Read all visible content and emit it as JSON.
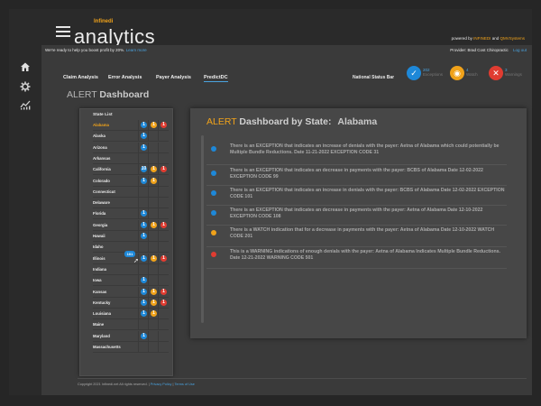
{
  "brand": {
    "small": "Infinedi",
    "big": "analytics"
  },
  "powered_by": {
    "prefix": "powered by",
    "infinedi": "INFINEDI",
    "and": "and",
    "qmv": "QMVSystems"
  },
  "promo": {
    "text": "We're ready to help you boost profit by 20%.",
    "link": "Learn more"
  },
  "provider": {
    "label": "Provider: Brad Cost Chiropractic",
    "logout": "Log out"
  },
  "tabs": [
    {
      "label": "Claim Analysis"
    },
    {
      "label": "Error Analysis"
    },
    {
      "label": "Payer Analysis"
    },
    {
      "label": "PredictDC"
    }
  ],
  "national_status": {
    "label": "National Status Bar",
    "items": [
      {
        "count": "202",
        "label": "Exceptions",
        "color": "#1e88d8",
        "icon": "check-icon"
      },
      {
        "count": "4",
        "label": "Watch",
        "color": "#f0a21a",
        "icon": "eye-icon"
      },
      {
        "count": "3",
        "label": "Warnings",
        "color": "#e03c31",
        "icon": "x-icon"
      }
    ]
  },
  "page": {
    "title_prefix": "ALERT",
    "title_bold": "Dashboard"
  },
  "state_list": {
    "heading": "State List",
    "selected": "Alabama",
    "badge": "101",
    "rows": [
      {
        "name": "Alabama",
        "b": "1",
        "o": "1",
        "r": "1"
      },
      {
        "name": "Alaska",
        "b": "1",
        "o": "",
        "r": ""
      },
      {
        "name": "Arizona",
        "b": "1",
        "o": "",
        "r": ""
      },
      {
        "name": "Arkansas",
        "b": "",
        "o": "",
        "r": ""
      },
      {
        "name": "California",
        "b": "10",
        "o": "1",
        "r": "1"
      },
      {
        "name": "Colorado",
        "b": "1",
        "o": "1",
        "r": ""
      },
      {
        "name": "Connecticut",
        "b": "",
        "o": "",
        "r": ""
      },
      {
        "name": "Delaware",
        "b": "",
        "o": "",
        "r": ""
      },
      {
        "name": "Florida",
        "b": "1",
        "o": "",
        "r": ""
      },
      {
        "name": "Georgia",
        "b": "1",
        "o": "1",
        "r": "1"
      },
      {
        "name": "Hawaii",
        "b": "1",
        "o": "",
        "r": ""
      },
      {
        "name": "Idaho",
        "b": "",
        "o": "",
        "r": ""
      },
      {
        "name": "Illinois",
        "b": "1",
        "o": "1",
        "r": "1"
      },
      {
        "name": "Indiana",
        "b": "",
        "o": "",
        "r": ""
      },
      {
        "name": "Iowa",
        "b": "1",
        "o": "",
        "r": ""
      },
      {
        "name": "Kansas",
        "b": "1",
        "o": "1",
        "r": "1"
      },
      {
        "name": "Kentucky",
        "b": "1",
        "o": "1",
        "r": "1"
      },
      {
        "name": "Louisiana",
        "b": "1",
        "o": "1",
        "r": ""
      },
      {
        "name": "Maine",
        "b": "",
        "o": "",
        "r": ""
      },
      {
        "name": "Maryland",
        "b": "1",
        "o": "",
        "r": ""
      },
      {
        "name": "Massachusetts",
        "b": "",
        "o": "",
        "r": ""
      }
    ]
  },
  "detail": {
    "title_alert": "ALERT",
    "title_rest": "Dashboard by State:",
    "state": "Alabama",
    "alerts": [
      {
        "level": "b",
        "text": "There is an EXCEPTION that indicates an increase of denials with the payer:  Aetna of Alabama which could potentially be Multiple Bundle Reductions.  Date 11-21-2022   EXCEPTION CODE 31"
      },
      {
        "level": "b",
        "text": "There is an EXCEPTION that indicates an decrease in payments with the payer: BCBS of Alabama  Date 12-02-2022   EXCEPTION CODE 99"
      },
      {
        "level": "b",
        "text": "There is an EXCEPTION that indicates an increase  in  denials with the payer: BCBS of Alabama  Date 12-02-2022   EXCEPTION CODE 101"
      },
      {
        "level": "b",
        "text": "There is an EXCEPTION that indicates an decrease in payments with the payer: Aetna of Alabama  Date 12-10-2022   EXCEPTION CODE 108"
      },
      {
        "level": "o",
        "text": "There is a WATCH indication that for a decrease in payments with the payer:  Aetna of Alabama  Date 12-10-2022   WATCH CODE 201"
      },
      {
        "level": "r",
        "text": "This is a WARNING indications of enough denials with the payer:  Aetna of Alabama  Indicates Multiple Bundle Reductions.  Date 12-21-2022   WARNING CODE 501"
      }
    ]
  },
  "footer": {
    "copyright": "Copyright 2021 Infinedi.net All rights reserved.  |",
    "privacy": "Privacy Policy",
    "sep": "|",
    "terms": "Terms of Use"
  }
}
